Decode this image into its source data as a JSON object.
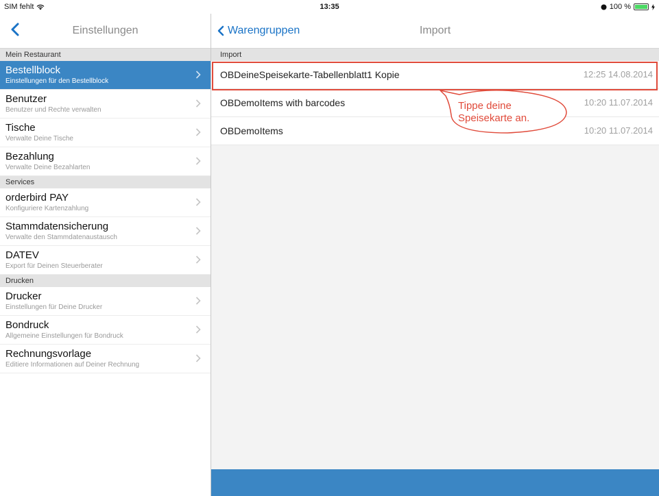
{
  "status": {
    "carrier": "SIM fehlt",
    "time": "13:35",
    "battery": "100 %",
    "battery_level": 1.0
  },
  "left": {
    "title": "Einstellungen",
    "sections": [
      {
        "label": "Mein Restaurant",
        "rows": [
          {
            "title": "Bestellblock",
            "subtitle": "Einstellungen für den Bestellblock",
            "selected": true
          },
          {
            "title": "Benutzer",
            "subtitle": "Benutzer und Rechte verwalten"
          },
          {
            "title": "Tische",
            "subtitle": "Verwalte Deine Tische"
          },
          {
            "title": "Bezahlung",
            "subtitle": "Verwalte Deine Bezahlarten"
          }
        ]
      },
      {
        "label": "Services",
        "rows": [
          {
            "title": "orderbird PAY",
            "subtitle": "Konfiguriere Kartenzahlung"
          },
          {
            "title": "Stammdatensicherung",
            "subtitle": "Verwalte den Stammdatenaustausch"
          },
          {
            "title": "DATEV",
            "subtitle": "Export für Deinen Steuerberater"
          }
        ]
      },
      {
        "label": "Drucken",
        "rows": [
          {
            "title": "Drucker",
            "subtitle": "Einstellungen für Deine Drucker"
          },
          {
            "title": "Bondruck",
            "subtitle": "Allgemeine Einstellungen für Bondruck"
          },
          {
            "title": "Rechnungsvorlage",
            "subtitle": "Editiere Informationen auf Deiner Rechnung"
          }
        ]
      }
    ]
  },
  "right": {
    "back_label": "Warengruppen",
    "title": "Import",
    "section_label": "Import",
    "items": [
      {
        "name": "OBDeineSpeisekarte-Tabellenblatt1 Kopie",
        "date": "12:25 14.08.2014"
      },
      {
        "name": "OBDemoItems with barcodes",
        "date": "10:20 11.07.2014"
      },
      {
        "name": "OBDemoItems",
        "date": "10:20 11.07.2014"
      }
    ],
    "callout": "Tippe deine Speisekarte an."
  },
  "colors": {
    "accent": "#3b86c4",
    "link": "#1a73c6",
    "annotation": "#e04a3a"
  }
}
